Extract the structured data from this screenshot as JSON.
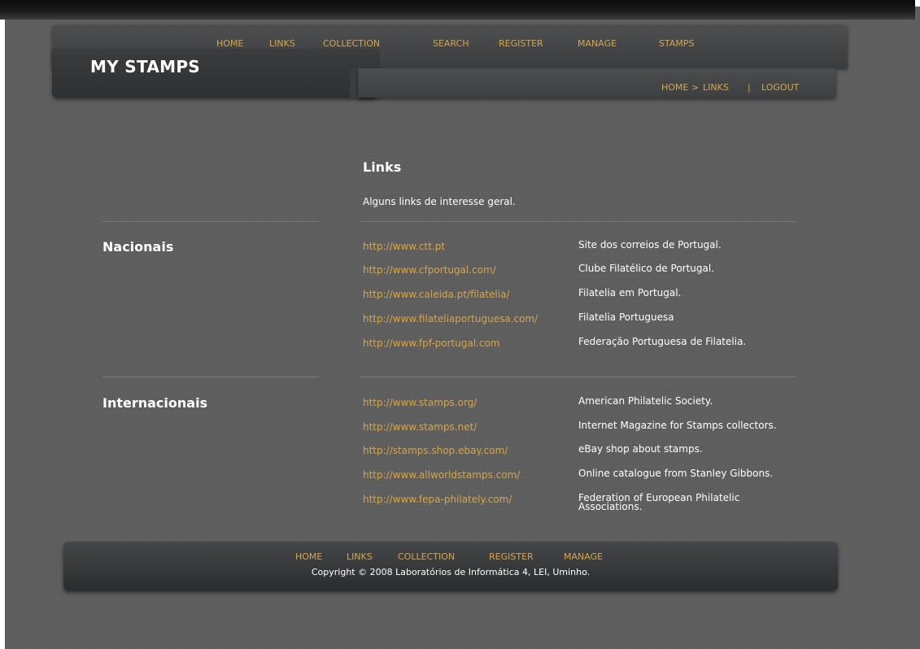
{
  "site": {
    "logo": "MY STAMPS"
  },
  "topnav": [
    {
      "label": "HOME"
    },
    {
      "label": "LINKS"
    },
    {
      "label": "COLLECTION"
    },
    {
      "label": "SEARCH"
    },
    {
      "label": "REGISTER"
    },
    {
      "label": "MANAGE"
    },
    {
      "label": "STAMPS"
    }
  ],
  "breadcrumb": {
    "home": "HOME",
    "arrow": ">",
    "current": "LINKS",
    "separator": "|",
    "logout": "LOGOUT"
  },
  "main": {
    "title": "Links",
    "intro": "Alguns links de interesse geral.",
    "sections": [
      {
        "title": "Nacionais",
        "links": [
          {
            "url": "http://www.ctt.pt",
            "desc": "Site dos correios de Portugal."
          },
          {
            "url": "http://www.cfportugal.com/",
            "desc": "Clube Filatélico de Portugal."
          },
          {
            "url": "http://www.caleida.pt/filatelia/",
            "desc": "Filatelia em Portugal."
          },
          {
            "url": "http://www.filateliaportuguesa.com/",
            "desc": "Filatelia Portuguesa"
          },
          {
            "url": "http://www.fpf-portugal.com",
            "desc": "Federação Portuguesa de Filatelia."
          }
        ]
      },
      {
        "title": "Internacionais",
        "links": [
          {
            "url": "http://www.stamps.org/",
            "desc": "American Philatelic Society."
          },
          {
            "url": "http://www.stamps.net/",
            "desc": "Internet Magazine for Stamps collectors."
          },
          {
            "url": "http://stamps.shop.ebay.com/",
            "desc": "eBay shop about stamps."
          },
          {
            "url": "http://www.allworldstamps.com/",
            "desc": "Online catalogue from Stanley Gibbons."
          },
          {
            "url": "http://www.fepa-philately.com/",
            "desc": "Federation of European Philatelic Associations."
          }
        ]
      }
    ]
  },
  "footer": {
    "nav": [
      {
        "label": "HOME"
      },
      {
        "label": "LINKS"
      },
      {
        "label": "COLLECTION"
      },
      {
        "label": "REGISTER"
      },
      {
        "label": "MANAGE"
      }
    ],
    "copyright": "Copyright © 2008 Laboratórios de Informática 4, LEI, Uminho."
  }
}
